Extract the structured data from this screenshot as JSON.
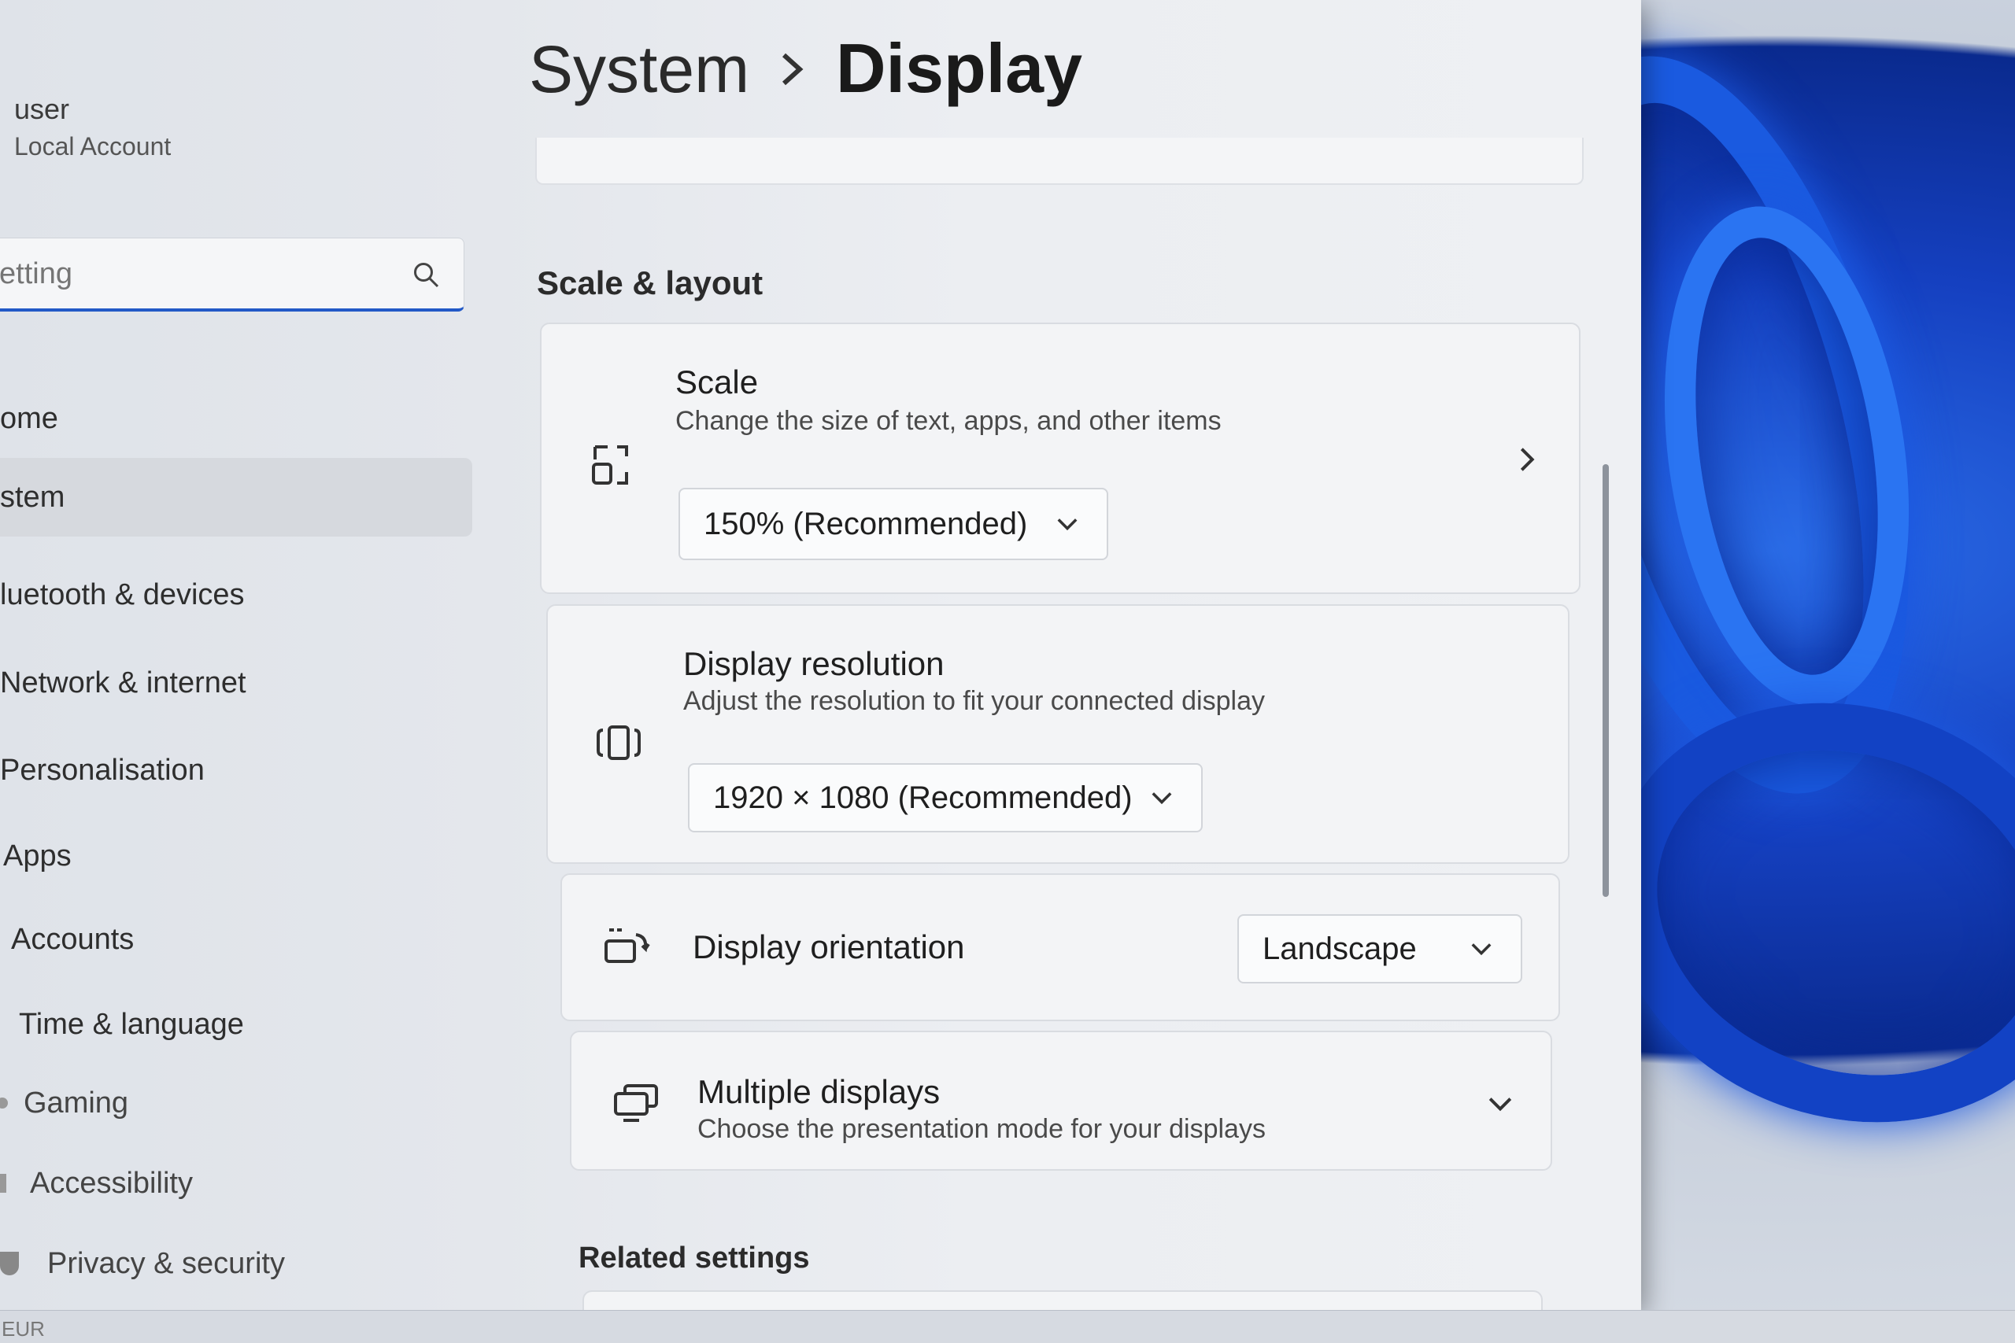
{
  "user": {
    "name": "user",
    "account_type": "Local Account"
  },
  "search": {
    "placeholder": "etting",
    "icon": "search-icon"
  },
  "sidebar": {
    "items": [
      {
        "label": "ome",
        "icon": "home-icon",
        "selected": false
      },
      {
        "label": "stem",
        "icon": "system-icon",
        "selected": true
      },
      {
        "label": "luetooth & devices",
        "icon": "bluetooth-icon",
        "selected": false
      },
      {
        "label": "Network & internet",
        "icon": "network-icon",
        "selected": false
      },
      {
        "label": "Personalisation",
        "icon": "brush-icon",
        "selected": false
      },
      {
        "label": "Apps",
        "icon": "apps-icon",
        "selected": false
      },
      {
        "label": "Accounts",
        "icon": "person-icon",
        "selected": false
      },
      {
        "label": "Time & language",
        "icon": "clock-icon",
        "selected": false
      },
      {
        "label": "Gaming",
        "icon": "gamepad-icon",
        "selected": false
      },
      {
        "label": "Accessibility",
        "icon": "accessibility-icon",
        "selected": false
      },
      {
        "label": "Privacy & security",
        "icon": "shield-icon",
        "selected": false
      }
    ]
  },
  "header": {
    "parent": "System",
    "separator_icon": "chevron-right-icon",
    "current": "Display"
  },
  "scale_layout": {
    "section_title": "Scale & layout",
    "scale": {
      "title": "Scale",
      "description": "Change the size of text, apps, and other items",
      "value": "150% (Recommended)",
      "icon": "scale-icon"
    },
    "resolution": {
      "title": "Display resolution",
      "description": "Adjust the resolution to fit your connected display",
      "value": "1920 × 1080 (Recommended)",
      "icon": "resolution-icon"
    },
    "orientation": {
      "title": "Display orientation",
      "value": "Landscape",
      "icon": "orientation-icon"
    },
    "multiple": {
      "title": "Multiple displays",
      "description": "Choose the presentation mode for your displays",
      "icon": "multiple-displays-icon"
    }
  },
  "related": {
    "section_title": "Related settings"
  },
  "taskbar": {
    "language": "EUR"
  },
  "colors": {
    "accent": "#2259c7",
    "wallpaper_blue": "#1650d8"
  }
}
